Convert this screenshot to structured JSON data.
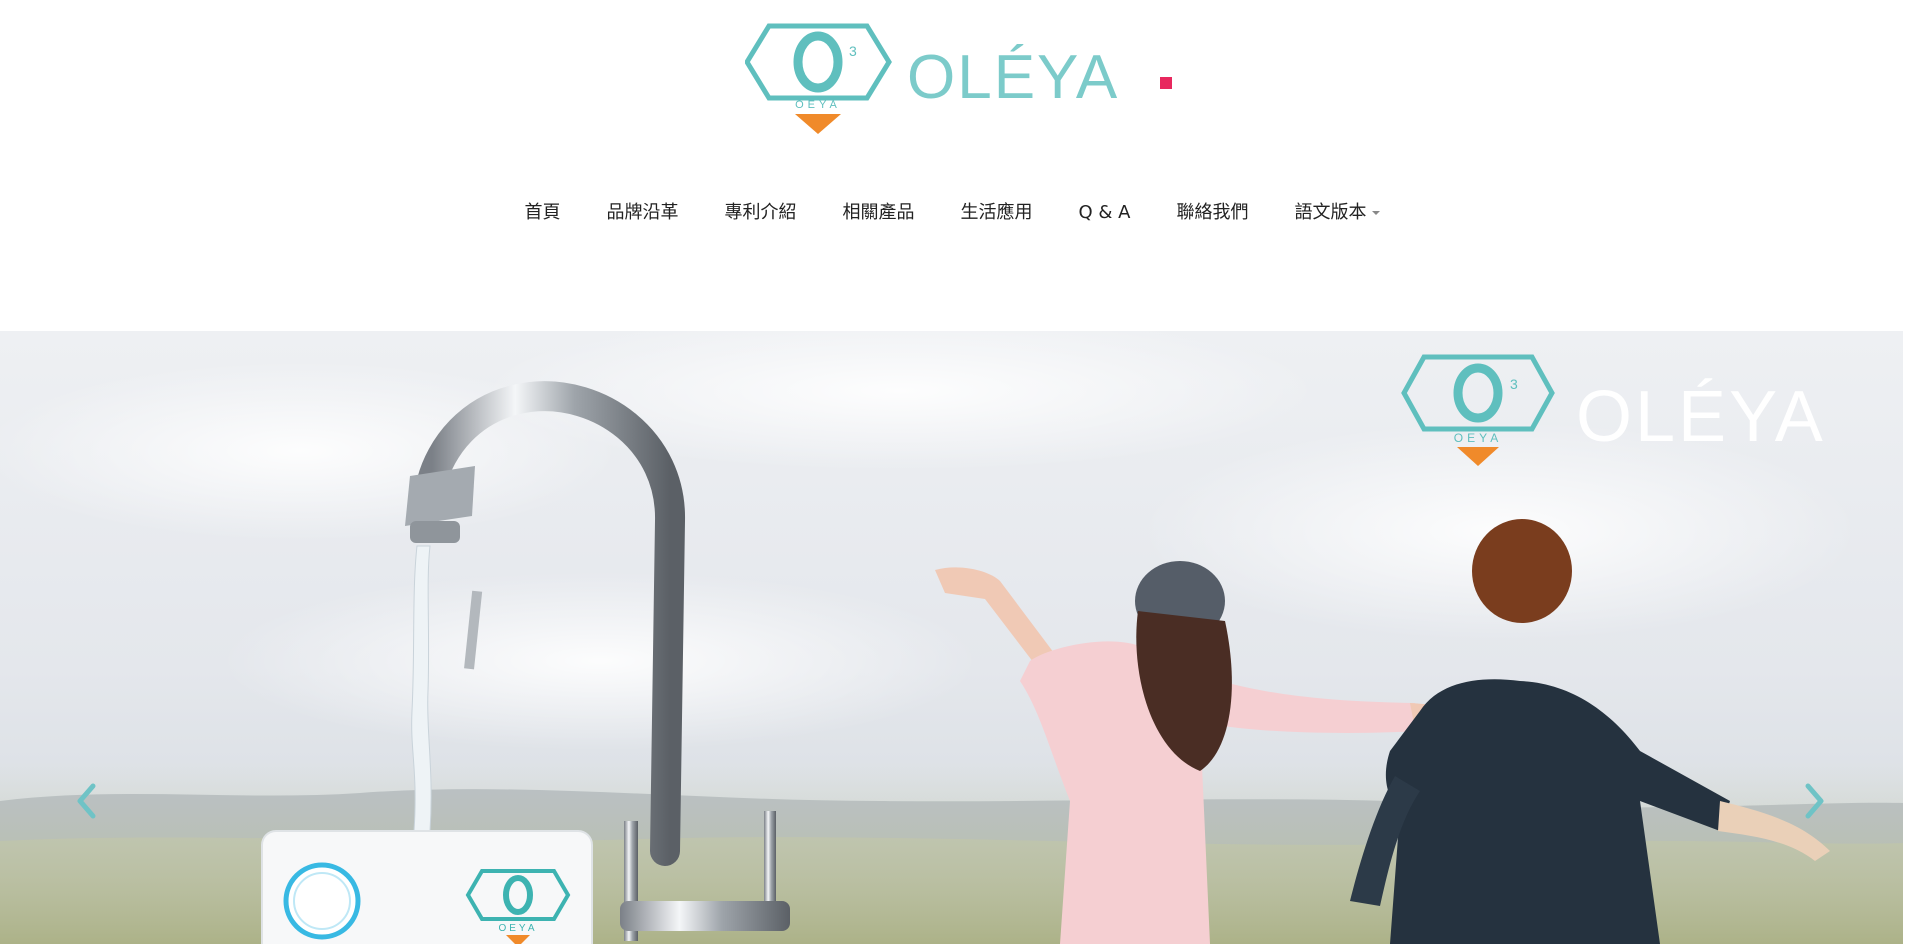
{
  "brand": {
    "wordmark": "OLÉYA",
    "emblem_text": "OEYA",
    "emblem_superscript": "3",
    "colors": {
      "teal": "#5fbfbe",
      "orange": "#f08a2a",
      "pink": "#e8285e"
    }
  },
  "nav": {
    "items": [
      {
        "label": "首頁"
      },
      {
        "label": "品牌沿革"
      },
      {
        "label": "專利介紹"
      },
      {
        "label": "相關產品"
      },
      {
        "label": "生活應用"
      },
      {
        "label": "Q & A"
      },
      {
        "label": "聯絡我們"
      },
      {
        "label": "語文版本",
        "dropdown": true
      }
    ]
  },
  "hero": {
    "overlay_wordmark": "OLÉYA",
    "overlay_emblem_text": "OEYA",
    "overlay_emblem_superscript": "3",
    "product_emblem_text": "OEYA",
    "prev_icon": "chevron-left-icon",
    "next_icon": "chevron-right-icon"
  }
}
